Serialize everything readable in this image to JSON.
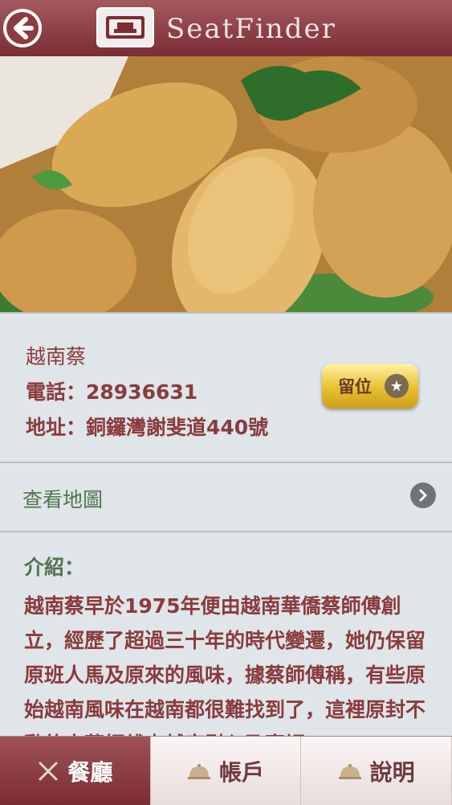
{
  "header": {
    "brand": "SeatFinder"
  },
  "restaurant": {
    "name": "越南蔡",
    "phone": "電話：28936631",
    "address": "地址：銅鑼灣謝斐道440號",
    "reserve_label": "留位"
  },
  "map": {
    "label": "查看地圖"
  },
  "intro": {
    "title": "介紹：",
    "text": "越南蔡早於1975年便由越南華僑蔡師傅創立，經歷了超過三十年的時代變遷，她仍保留原班人馬及原來的風味，據蔡師傅稱，有些原始越南風味在越南都很難找到了，這裡原封不動的由蔡師傅由越南引入及烹調"
  },
  "tabs": [
    {
      "label": "餐廳",
      "icon": "cutlery-icon",
      "active": true
    },
    {
      "label": "帳戶",
      "icon": "cloche-icon",
      "active": false
    },
    {
      "label": "說明",
      "icon": "cloche-icon",
      "active": false
    }
  ],
  "colors": {
    "header": "#7a2d33",
    "accent_red": "#8a3b3e",
    "accent_green": "#52734e",
    "button_gold": "#e7c12f"
  }
}
